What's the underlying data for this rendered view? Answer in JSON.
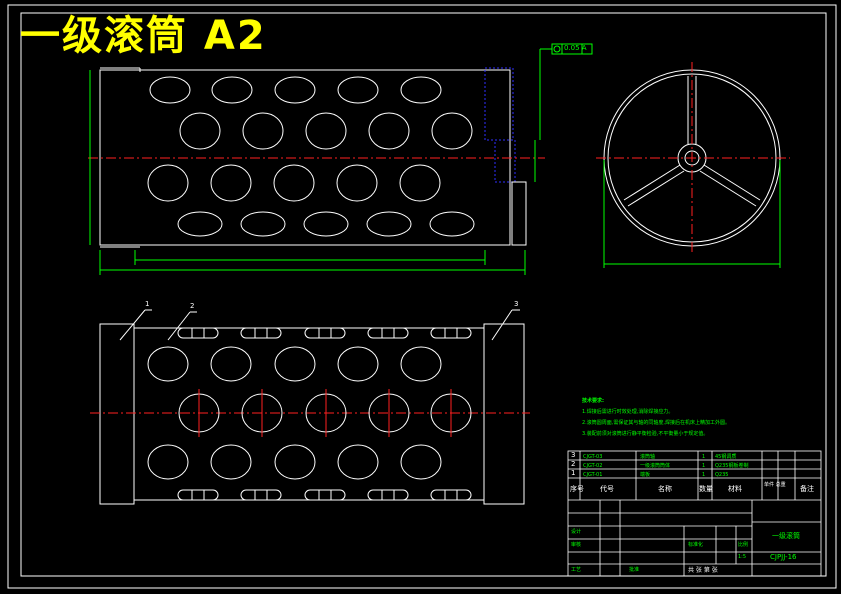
{
  "drawing": {
    "title": "一级滚筒  A2",
    "tolerance_frame": "0.05 A",
    "balloons": [
      "1",
      "2",
      "3"
    ]
  },
  "tech_notes": {
    "heading": "技术要求:",
    "items": [
      "1.焊接后需进行时效处理,消除焊接应力。",
      "2.滚筒圆周面,需保证其与轴的同轴度,焊接后在机床上精加工外圆。",
      "3.装配前须对滚筒进行静平衡检验,不平衡量小于规定值。"
    ]
  },
  "bom": {
    "rows": [
      {
        "no": "3",
        "code": "CJGT-03",
        "name": "滚筒轴",
        "qty": "1",
        "material": "45钢调质"
      },
      {
        "no": "2",
        "code": "CJGT-02",
        "name": "一级滚筒筒体",
        "qty": "1",
        "material": "Q235钢板卷制"
      },
      {
        "no": "1",
        "code": "CJGT-01",
        "name": "端板",
        "qty": "1",
        "material": "Q235"
      }
    ],
    "header": {
      "no": "序号",
      "code": "代号",
      "name": "名称",
      "qty": "数量",
      "material": "材料",
      "weight": "单件 总重",
      "note": "备注"
    }
  },
  "title_block": {
    "part_name": "一级滚筒",
    "drawing_no": "CJPJJ-16",
    "design": "设计",
    "check": "审核",
    "process": "工艺",
    "standard": "标准化",
    "approve": "批准",
    "scale_label": "比例",
    "scale": "1:5",
    "sheet": "共 张 第 张"
  },
  "colors": {
    "line": "#ffffff",
    "dim": "#00ff00",
    "center": "#ff0000",
    "hatch": "#0000ff",
    "title": "#ffff00"
  }
}
